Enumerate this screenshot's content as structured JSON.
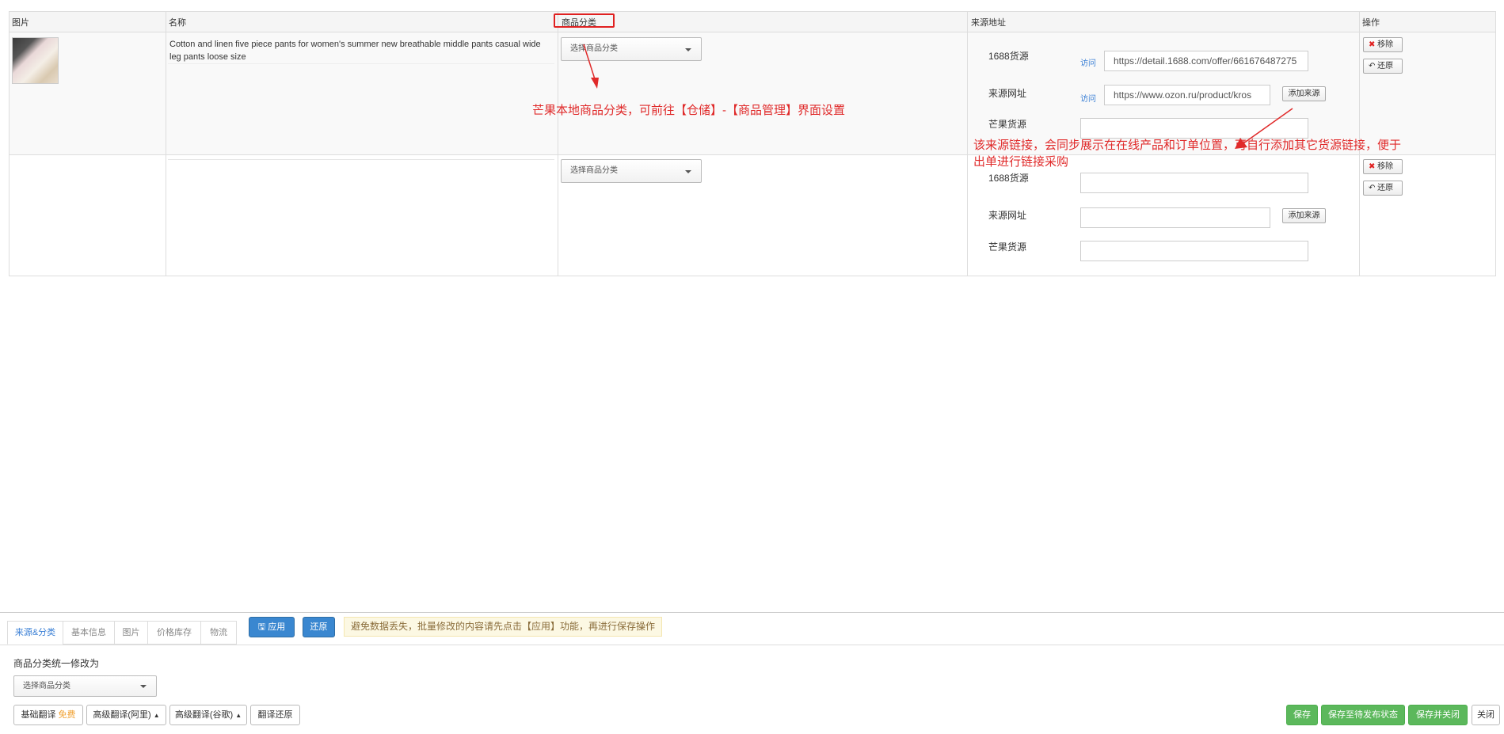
{
  "table": {
    "headers": {
      "image": "图片",
      "name": "名称",
      "category": "商品分类",
      "source": "来源地址",
      "actions": "操作"
    },
    "rows": [
      {
        "name": "Cotton and linen five piece pants for women's summer new breathable middle pants casual wide leg pants loose size",
        "category_placeholder": "选择商品分类",
        "source_1688_label": "1688货源",
        "source_url_label": "来源网址",
        "mango_label": "芒果货源",
        "visit_label": "访问",
        "visit_label_2": "访问",
        "source_1688_value": "https://detail.1688.com/offer/661676487275",
        "source_url_value": "https://www.ozon.ru/product/kros",
        "add_source": "添加来源",
        "remove": "移除",
        "restore": "还原"
      },
      {
        "name": "",
        "category_placeholder": "选择商品分类",
        "source_1688_label": "1688货源",
        "source_url_label": "来源网址",
        "mango_label": "芒果货源",
        "add_source": "添加来源",
        "remove": "移除",
        "restore": "还原"
      }
    ]
  },
  "annotations": {
    "category_note": "芒果本地商品分类，可前往【仓储】-【商品管理】界面设置",
    "source_note_line1": "该来源链接，会同步展示在在线产品和订单位置，可自行添加其它货源链接，便于",
    "source_note_line2": "出单进行链接采购"
  },
  "bottom": {
    "tabs": [
      "来源&分类",
      "基本信息",
      "图片",
      "价格库存",
      "物流"
    ],
    "apply": "应用",
    "restore": "还原",
    "warning": "避免数据丢失，批量修改的内容请先点击【应用】功能，再进行保存操作",
    "batch_label": "商品分类统一修改为",
    "batch_placeholder": "选择商品分类",
    "translate_basic": "基础翻译",
    "translate_free": "免费",
    "translate_ali": "高级翻译(阿里)",
    "translate_google": "高级翻译(谷歌)",
    "translate_restore": "翻译还原",
    "save": "保存",
    "save_pending": "保存至待发布状态",
    "save_close": "保存并关闭",
    "close": "关闭"
  },
  "colors": {
    "accent": "#3a87d0",
    "green": "#5cb85c",
    "annotation": "#e02a2a"
  }
}
